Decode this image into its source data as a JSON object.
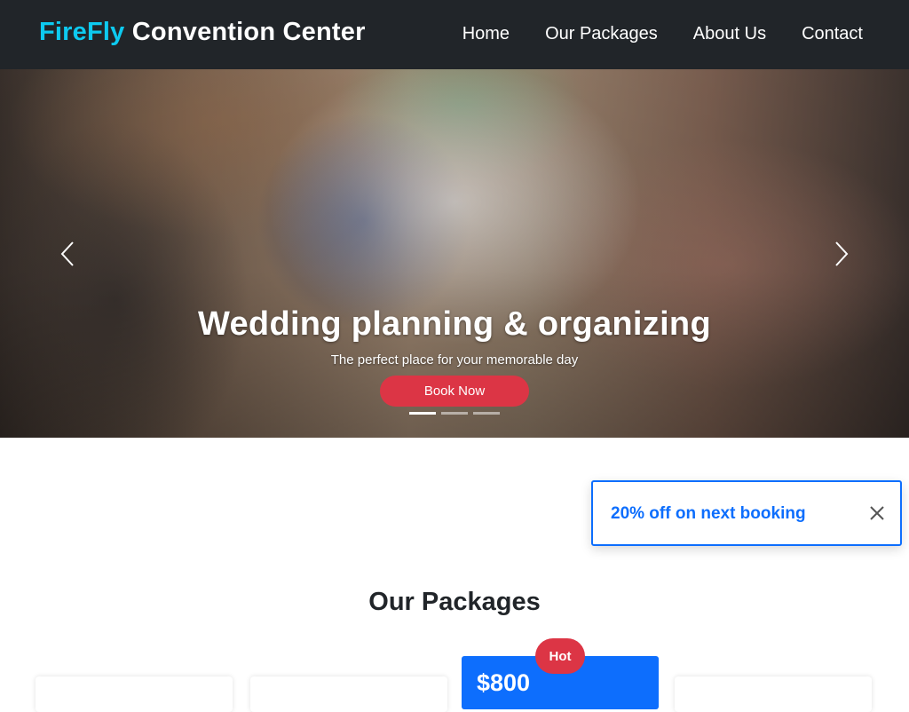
{
  "navbar": {
    "brand_accent": "FireFly",
    "brand_rest": "Convention Center",
    "links": [
      "Home",
      "Our Packages",
      "About Us",
      "Contact"
    ]
  },
  "hero": {
    "title": "Wedding planning & organizing",
    "subtitle": "The perfect place for your memorable day",
    "button_label": "Book Now",
    "slide_count": 3,
    "active_slide": 1,
    "prev_icon": "chevron-left-icon",
    "next_icon": "chevron-right-icon"
  },
  "toast": {
    "message": "20% off on next booking",
    "close_icon": "close-icon"
  },
  "packages": {
    "title": "Our Packages",
    "featured_badge": "Hot",
    "featured_price": "$800"
  },
  "colors": {
    "navbar_bg": "#212529",
    "brand_accent": "#0dcaf0",
    "button_red": "#dc3545",
    "primary_blue": "#0d6efd"
  }
}
